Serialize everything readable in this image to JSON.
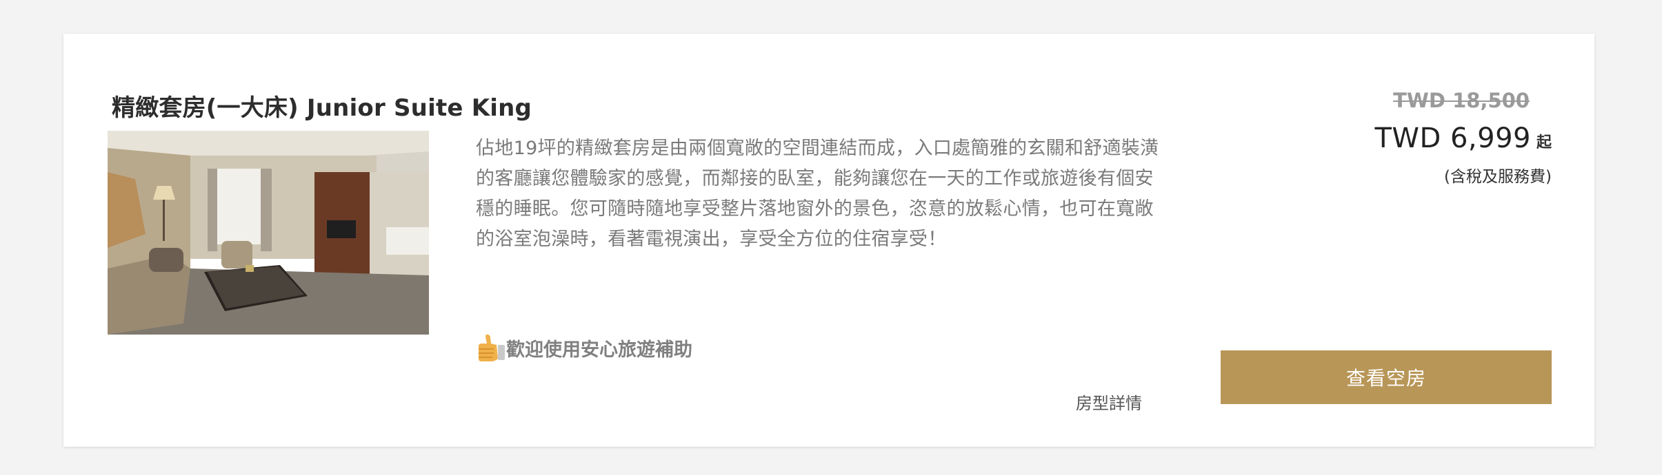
{
  "room": {
    "title": "精緻套房(一大床) Junior Suite King",
    "description": "佔地19坪的精緻套房是由兩個寬敞的空間連結而成，入口處簡雅的玄關和舒適裝潢的客廳讓您體驗家的感覺，而鄰接的臥室，能夠讓您在一天的工作或旅遊後有個安穩的睡眠。您可隨時隨地享受整片落地窗外的景色，恣意的放鬆心情，也可在寬敞的浴室泡澡時，看著電視演出，享受全方位的住宿享受！",
    "subsidy_text": "歡迎使用安心旅遊補助",
    "details_link": "房型詳情",
    "photo_icon": "hotel-suite-photo"
  },
  "pricing": {
    "original": "TWD 18,500",
    "current": "TWD 6,999",
    "from_label": "起",
    "note": "(含稅及服務費)"
  },
  "actions": {
    "book_label": "查看空房"
  },
  "colors": {
    "accent": "#b89658",
    "background": "#f3f3f3",
    "card": "#ffffff"
  }
}
